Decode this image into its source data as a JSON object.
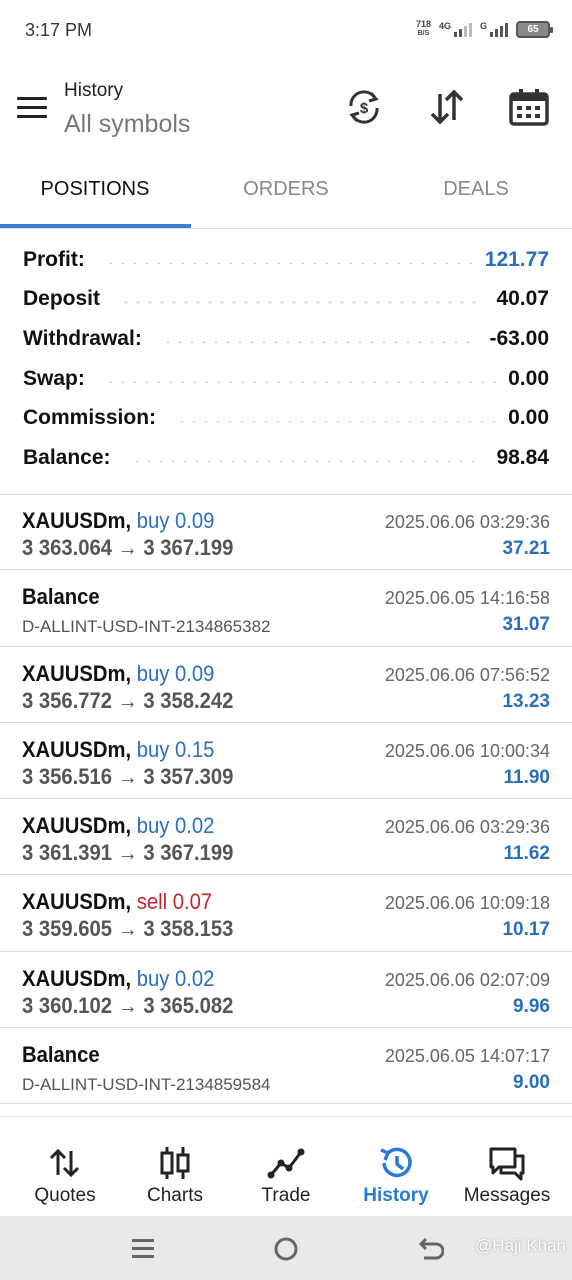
{
  "status_bar": {
    "time": "3:17 PM",
    "net_speed_value": "718",
    "net_speed_unit": "B/S",
    "net_type_1": "4G",
    "net_type_2": "G",
    "battery": "65"
  },
  "header": {
    "title": "History",
    "subtitle": "All symbols",
    "icons": [
      "currency-sync-icon",
      "sort-icon",
      "calendar-icon"
    ]
  },
  "tabs": [
    {
      "label": "POSITIONS",
      "active": true
    },
    {
      "label": "ORDERS",
      "active": false
    },
    {
      "label": "DEALS",
      "active": false
    }
  ],
  "summary": [
    {
      "label": "Profit:",
      "value": "121.77"
    },
    {
      "label": "Deposit",
      "value": "40.07"
    },
    {
      "label": "Withdrawal:",
      "value": "-63.00"
    },
    {
      "label": "Swap:",
      "value": "0.00"
    },
    {
      "label": "Commission:",
      "value": "0.00"
    },
    {
      "label": "Balance:",
      "value": "98.84"
    }
  ],
  "history": [
    {
      "symbol": "XAUUSDm,",
      "direction": "buy 0.09",
      "open": "3 363.064",
      "close": "3 367.199",
      "time": "2025.06.06 03:29:36",
      "profit": "37.21"
    },
    {
      "symbol": "Balance",
      "comment": "D-ALLINT-USD-INT-2134865382",
      "time": "2025.06.05 14:16:58",
      "profit": "31.07"
    },
    {
      "symbol": "XAUUSDm,",
      "direction": "buy 0.09",
      "open": "3 356.772",
      "close": "3 358.242",
      "time": "2025.06.06 07:56:52",
      "profit": "13.23"
    },
    {
      "symbol": "XAUUSDm,",
      "direction": "buy 0.15",
      "open": "3 356.516",
      "close": "3 357.309",
      "time": "2025.06.06 10:00:34",
      "profit": "11.90"
    },
    {
      "symbol": "XAUUSDm,",
      "direction": "buy 0.02",
      "open": "3 361.391",
      "close": "3 367.199",
      "time": "2025.06.06 03:29:36",
      "profit": "11.62"
    },
    {
      "symbol": "XAUUSDm,",
      "direction": "sell 0.07",
      "open": "3 359.605",
      "close": "3 358.153",
      "time": "2025.06.06 10:09:18",
      "profit": "10.17"
    },
    {
      "symbol": "XAUUSDm,",
      "direction": "buy 0.02",
      "open": "3 360.102",
      "close": "3 365.082",
      "time": "2025.06.06 02:07:09",
      "profit": "9.96"
    },
    {
      "symbol": "Balance",
      "comment": "D-ALLINT-USD-INT-2134859584",
      "time": "2025.06.05 14:07:17",
      "profit": "9.00"
    }
  ],
  "price_arrow": "→",
  "bottom_nav": [
    {
      "label": "Quotes",
      "icon": "quotes-arrows-icon"
    },
    {
      "label": "Charts",
      "icon": "candlestick-icon"
    },
    {
      "label": "Trade",
      "icon": "trade-line-icon"
    },
    {
      "label": "History",
      "icon": "history-clock-icon",
      "active": true
    },
    {
      "label": "Messages",
      "icon": "messages-icon"
    }
  ],
  "watermark": "@Haji Khan",
  "colors": {
    "accent_blue": "#2a6fbe",
    "sell_red": "#c0262d",
    "tab_underline": "#3a7ed8",
    "nav_active": "#2a7ad6"
  }
}
